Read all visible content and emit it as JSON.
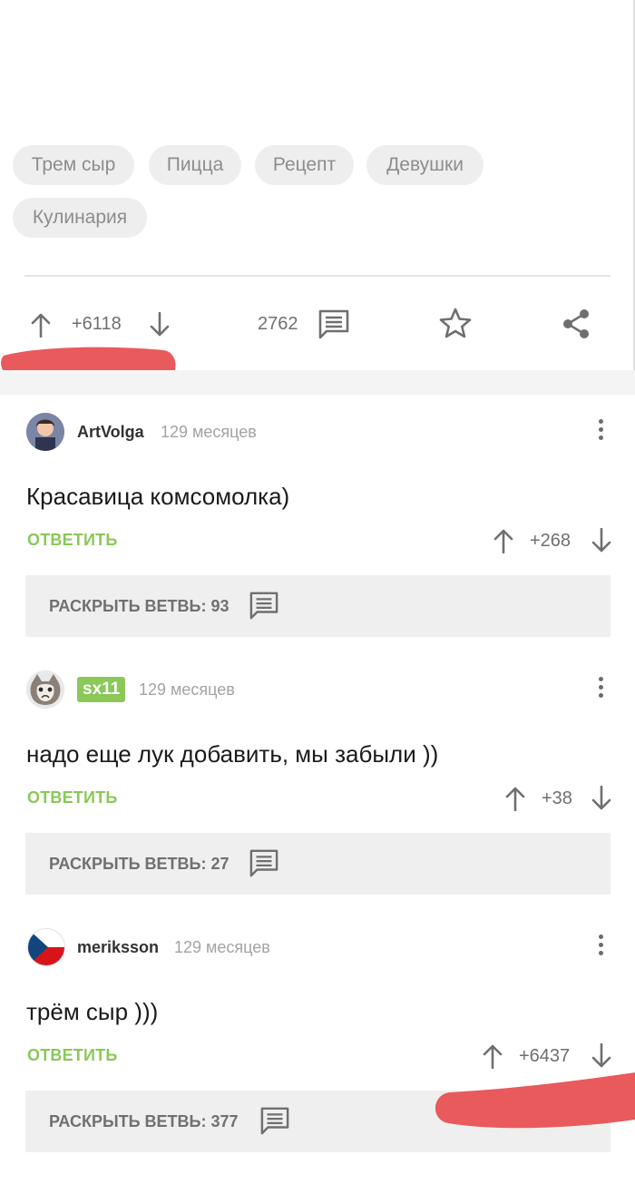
{
  "post": {
    "tags": [
      "Трем сыр",
      "Пицца",
      "Рецепт",
      "Девушки",
      "Кулинария"
    ],
    "rating": "+6118",
    "comments_count": "2762"
  },
  "comments": [
    {
      "username": "ArtVolga",
      "time": "129 месяцев",
      "text": "Красавица комсомолка)",
      "reply_label": "ОТВЕТИТЬ",
      "rating": "+268",
      "branch_label": "РАСКРЫТЬ ВЕТВЬ: 93"
    },
    {
      "username": "sx11",
      "time": "129 месяцев",
      "text": "надо еще лук добавить, мы забыли ))",
      "reply_label": "ОТВЕТИТЬ",
      "rating": "+38",
      "branch_label": "РАСКРЫТЬ ВЕТВЬ: 27"
    },
    {
      "username": "meriksson",
      "time": "129 месяцев",
      "text": "трём сыр )))",
      "reply_label": "ОТВЕТИТЬ",
      "rating": "+6437",
      "branch_label": "РАСКРЫТЬ ВЕТВЬ: 377"
    }
  ],
  "colors": {
    "accent_green": "#8ac858",
    "redaction": "#e85a5c"
  },
  "icons": [
    "arrow-up-icon",
    "arrow-down-icon",
    "comment-icon",
    "star-icon",
    "share-icon",
    "more-vertical-icon"
  ]
}
